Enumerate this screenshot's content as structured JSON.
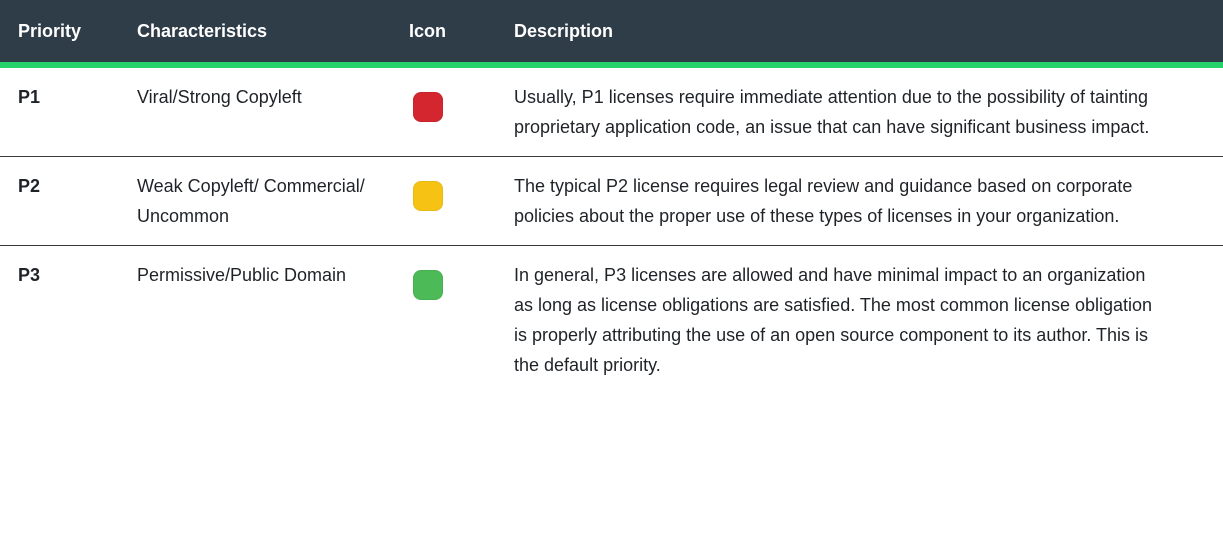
{
  "table": {
    "headers": {
      "priority": "Priority",
      "characteristics": "Characteristics",
      "icon": "Icon",
      "description": "Description"
    },
    "rows": [
      {
        "priority": "P1",
        "characteristics": "Viral/Strong Copyleft",
        "icon_name": "red-priority-square-icon",
        "icon_color": "#d3262f",
        "description": "Usually, P1 licenses require immediate attention due to the possibility of tainting proprietary application code, an issue that can have significant business impact."
      },
      {
        "priority": "P2",
        "characteristics": "Weak Copyleft/ Commercial/ Uncommon",
        "icon_name": "yellow-priority-square-icon",
        "icon_color": "#f6c315",
        "description": "The typical P2 license requires legal review and guidance based on corporate policies about the proper use of these types of licenses in your organization."
      },
      {
        "priority": "P3",
        "characteristics": "Permissive/Public Domain",
        "icon_name": "green-priority-square-icon",
        "icon_color": "#4bba57",
        "description": "In general, P3 licenses are allowed and have minimal impact to an organization as long as license obligations are satisfied. The most common license obligation is properly attributing the use of an open source component to its author. This is the default priority."
      }
    ]
  },
  "colors": {
    "header_bg": "#2f3d49",
    "header_accent": "#26d36a"
  }
}
